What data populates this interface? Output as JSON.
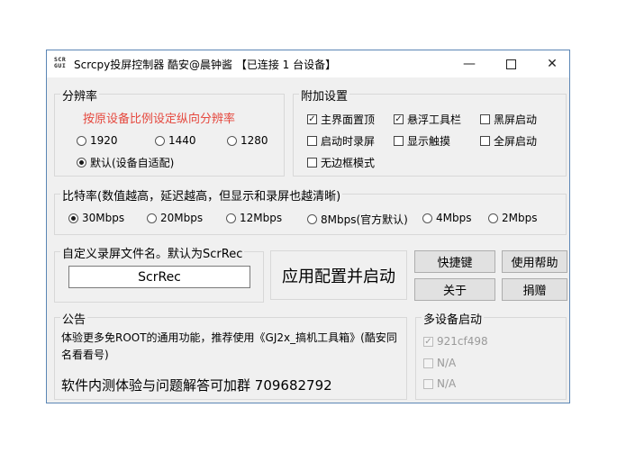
{
  "window": {
    "title": "Scrcpy投屏控制器 酷安@晨钟酱 【已连接 1 台设备】",
    "icon_text": "SCR\nGUI",
    "controls": {
      "minimize": "—",
      "close": "✕"
    }
  },
  "resolution": {
    "label": "分辨率",
    "hint": "按原设备比例设定纵向分辨率",
    "options": [
      {
        "label": "1920",
        "selected": false
      },
      {
        "label": "1440",
        "selected": false
      },
      {
        "label": "1280",
        "selected": false
      },
      {
        "label": "默认(设备自适配)",
        "selected": true
      }
    ]
  },
  "extras": {
    "label": "附加设置",
    "options": [
      {
        "label": "主界面置顶",
        "checked": true
      },
      {
        "label": "悬浮工具栏",
        "checked": true
      },
      {
        "label": "黑屏启动",
        "checked": false
      },
      {
        "label": "启动时录屏",
        "checked": false
      },
      {
        "label": "显示触摸",
        "checked": false
      },
      {
        "label": "全屏启动",
        "checked": false
      },
      {
        "label": "无边框模式",
        "checked": false
      }
    ]
  },
  "bitrate": {
    "label": "比特率(数值越高，延迟越高，但显示和录屏也越清晰)",
    "options": [
      {
        "label": "30Mbps",
        "selected": true
      },
      {
        "label": "20Mbps",
        "selected": false
      },
      {
        "label": "12Mbps",
        "selected": false
      },
      {
        "label": "8Mbps(官方默认)",
        "selected": false
      },
      {
        "label": "4Mbps",
        "selected": false
      },
      {
        "label": "2Mbps",
        "selected": false
      }
    ]
  },
  "record": {
    "label": "自定义录屏文件名。默认为ScrRec",
    "value": "ScrRec"
  },
  "buttons": {
    "apply": "应用配置并启动",
    "shortcuts": "快捷键",
    "help": "使用帮助",
    "about": "关于",
    "donate": "捐赠"
  },
  "notice": {
    "label": "公告",
    "text": "体验更多免ROOT的通用功能，推荐使用《GJ2x_搞机工具箱》(酷安同名看看号)",
    "group": "软件内测体验与问题解答可加群 709682792"
  },
  "multi": {
    "label": "多设备启动",
    "devices": [
      {
        "label": "921cf498",
        "checked": true
      },
      {
        "label": "N/A",
        "checked": false
      },
      {
        "label": "N/A",
        "checked": false
      }
    ]
  }
}
